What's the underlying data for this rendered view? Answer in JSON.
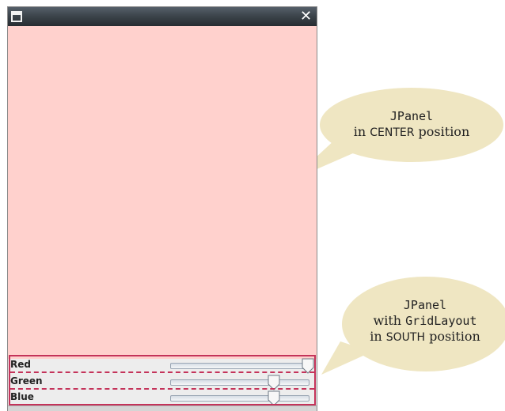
{
  "window": {
    "close_glyph": "✕"
  },
  "sliders": [
    {
      "label": "Red",
      "value_fraction": 1.0
    },
    {
      "label": "Green",
      "value_fraction": 0.75
    },
    {
      "label": "Blue",
      "value_fraction": 0.75
    }
  ],
  "callouts": {
    "center": {
      "line1": "JPanel",
      "line2_prefix": "in ",
      "line2_code": "CENTER",
      "line2_suffix": " position"
    },
    "south": {
      "line1": "JPanel",
      "line2_prefix": "with ",
      "line2_code": "GridLayout",
      "line3_prefix": "in ",
      "line3_code": "SOUTH",
      "line3_suffix": " position"
    }
  },
  "colors": {
    "center_panel": "#ffd1cd",
    "annotation_frame": "#c4335a",
    "callout_fill": "#efe6c2"
  }
}
